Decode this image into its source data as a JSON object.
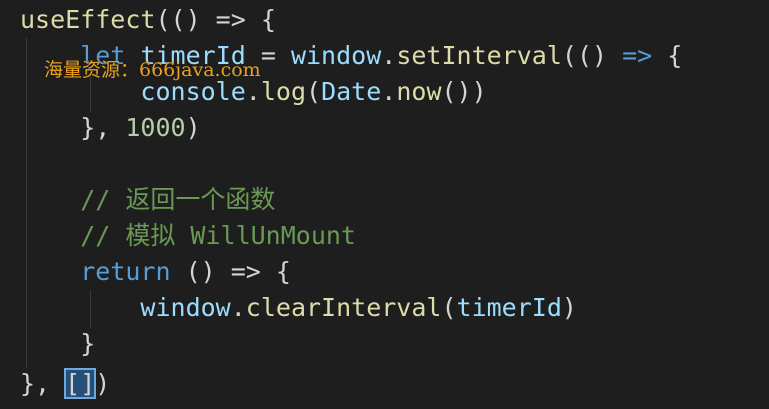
{
  "editor": {
    "lines": [
      "useEffect(() => {",
      "    let timerId = window.setInterval(() => {",
      "        console.log(Date.now())",
      "    }, 1000)",
      "",
      "    // 返回一个函数",
      "    // 模拟 WillUnMount",
      "    return () => {",
      "        window.clearInterval(timerId)",
      "    }",
      "}, [])"
    ]
  },
  "tokens": {
    "l1_fn": "useEffect",
    "l1_rest": "(() => {",
    "l2_kw": "let",
    "l2_var": "timerId",
    "l2_eq": " = ",
    "l2_obj": "window",
    "l2_dot": ".",
    "l2_fn": "setInterval",
    "l2_open": "(()",
    "l2_arrow": " => ",
    "l2_brace": "{",
    "l3_obj": "console",
    "l3_dot": ".",
    "l3_fn": "log",
    "l3_open": "(",
    "l3_date": "Date",
    "l3_dot2": ".",
    "l3_now": "now",
    "l3_close": "())",
    "l4_close": "}, ",
    "l4_num": "1000",
    "l4_paren": ")",
    "l6_comment": "// 返回一个函数",
    "l7_comment": "// 模拟 WillUnMount",
    "l8_kw": "return",
    "l8_rest": " () => {",
    "l9_obj": "window",
    "l9_dot": ".",
    "l9_fn": "clearInterval",
    "l9_open": "(",
    "l9_var": "timerId",
    "l9_close": ")",
    "l10_brace": "}",
    "l11_start": "}, ",
    "l11_brackets": "[]",
    "l11_paren": ")"
  },
  "watermark": {
    "text": "海量资源：666java.com"
  },
  "colors": {
    "background": "#1e1e1e",
    "function": "#dcdcaa",
    "keyword": "#569cd6",
    "variable": "#9cdcfe",
    "number": "#b5cea8",
    "comment": "#6a9955",
    "watermark": "#e8a020"
  }
}
